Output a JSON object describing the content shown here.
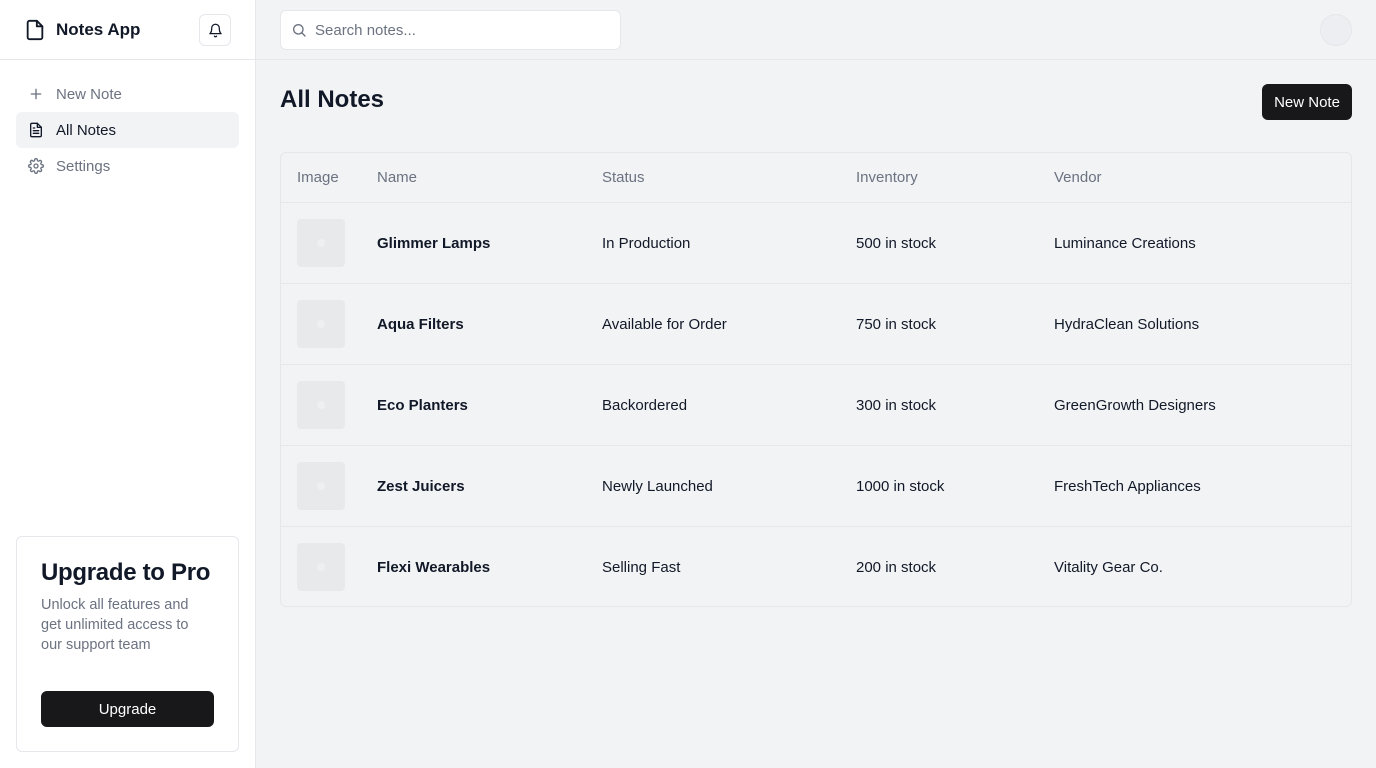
{
  "app": {
    "title": "Notes App"
  },
  "sidebar": {
    "items": [
      {
        "label": "New Note",
        "icon": "plus-icon",
        "active": false
      },
      {
        "label": "All Notes",
        "icon": "document-icon",
        "active": true
      },
      {
        "label": "Settings",
        "icon": "gear-icon",
        "active": false
      }
    ],
    "upgrade": {
      "title": "Upgrade to Pro",
      "description": "Unlock all features and get unlimited access to our support team",
      "button_label": "Upgrade"
    }
  },
  "search": {
    "placeholder": "Search notes...",
    "value": ""
  },
  "main": {
    "title": "All Notes",
    "new_note_label": "New Note",
    "table": {
      "headers": [
        "Image",
        "Name",
        "Status",
        "Inventory",
        "Vendor"
      ],
      "rows": [
        {
          "name": "Glimmer Lamps",
          "status": "In Production",
          "inventory": "500 in stock",
          "vendor": "Luminance Creations"
        },
        {
          "name": "Aqua Filters",
          "status": "Available for Order",
          "inventory": "750 in stock",
          "vendor": "HydraClean Solutions"
        },
        {
          "name": "Eco Planters",
          "status": "Backordered",
          "inventory": "300 in stock",
          "vendor": "GreenGrowth Designers"
        },
        {
          "name": "Zest Juicers",
          "status": "Newly Launched",
          "inventory": "1000 in stock",
          "vendor": "FreshTech Appliances"
        },
        {
          "name": "Flexi Wearables",
          "status": "Selling Fast",
          "inventory": "200 in stock",
          "vendor": "Vitality Gear Co."
        }
      ]
    }
  },
  "colors": {
    "primary_button": "#18181b",
    "muted_text": "#6b7280",
    "background": "#f2f3f5",
    "border": "#e5e7eb"
  }
}
